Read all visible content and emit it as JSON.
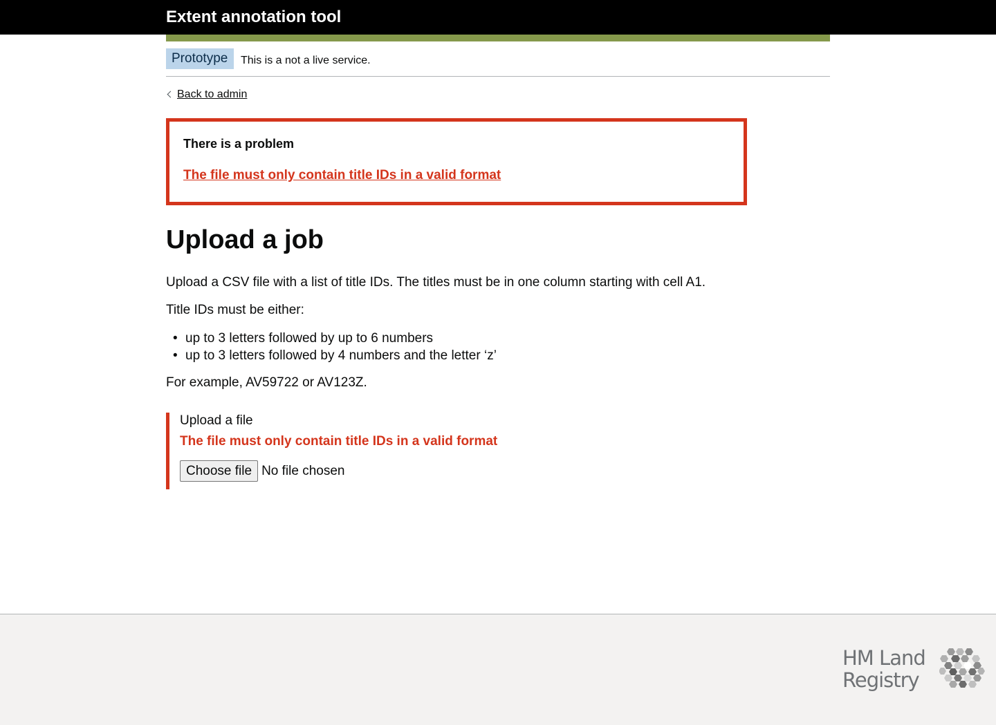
{
  "colors": {
    "header_bg": "#000000",
    "header_bar": "#85994b",
    "phase_tag_bg": "#bbd4ea",
    "phase_tag_text": "#0c2d4a",
    "error_red": "#d4351c",
    "footer_bg": "#f3f2f1",
    "logo_grey": "#6f7275"
  },
  "header": {
    "title": "Extent annotation tool"
  },
  "phase_banner": {
    "tag": "Prototype",
    "text": "This is a not a live service."
  },
  "back_link": {
    "label": "Back to admin",
    "icon": "chevron-left-icon"
  },
  "error_summary": {
    "title": "There is a problem",
    "error_link": "The file must only contain title IDs in a valid format"
  },
  "main": {
    "heading": "Upload a job",
    "intro": "Upload a CSV file with a list of title IDs. The titles must be in one column starting with cell A1.",
    "formats_lead": "Title IDs must be either:",
    "formats": [
      "up to 3 letters followed by up to 6 numbers",
      "up to 3 letters followed by 4 numbers and the letter ‘z’"
    ],
    "example": "For example, AV59722 or AV123Z."
  },
  "upload_field": {
    "label": "Upload a file",
    "error": "The file must only contain title IDs in a valid format",
    "button_label": "Choose file",
    "status": "No file chosen"
  },
  "footer": {
    "logo_line1": "HM Land",
    "logo_line2": "Registry",
    "logo_icon": "hm-land-registry-hexagon-logo"
  }
}
